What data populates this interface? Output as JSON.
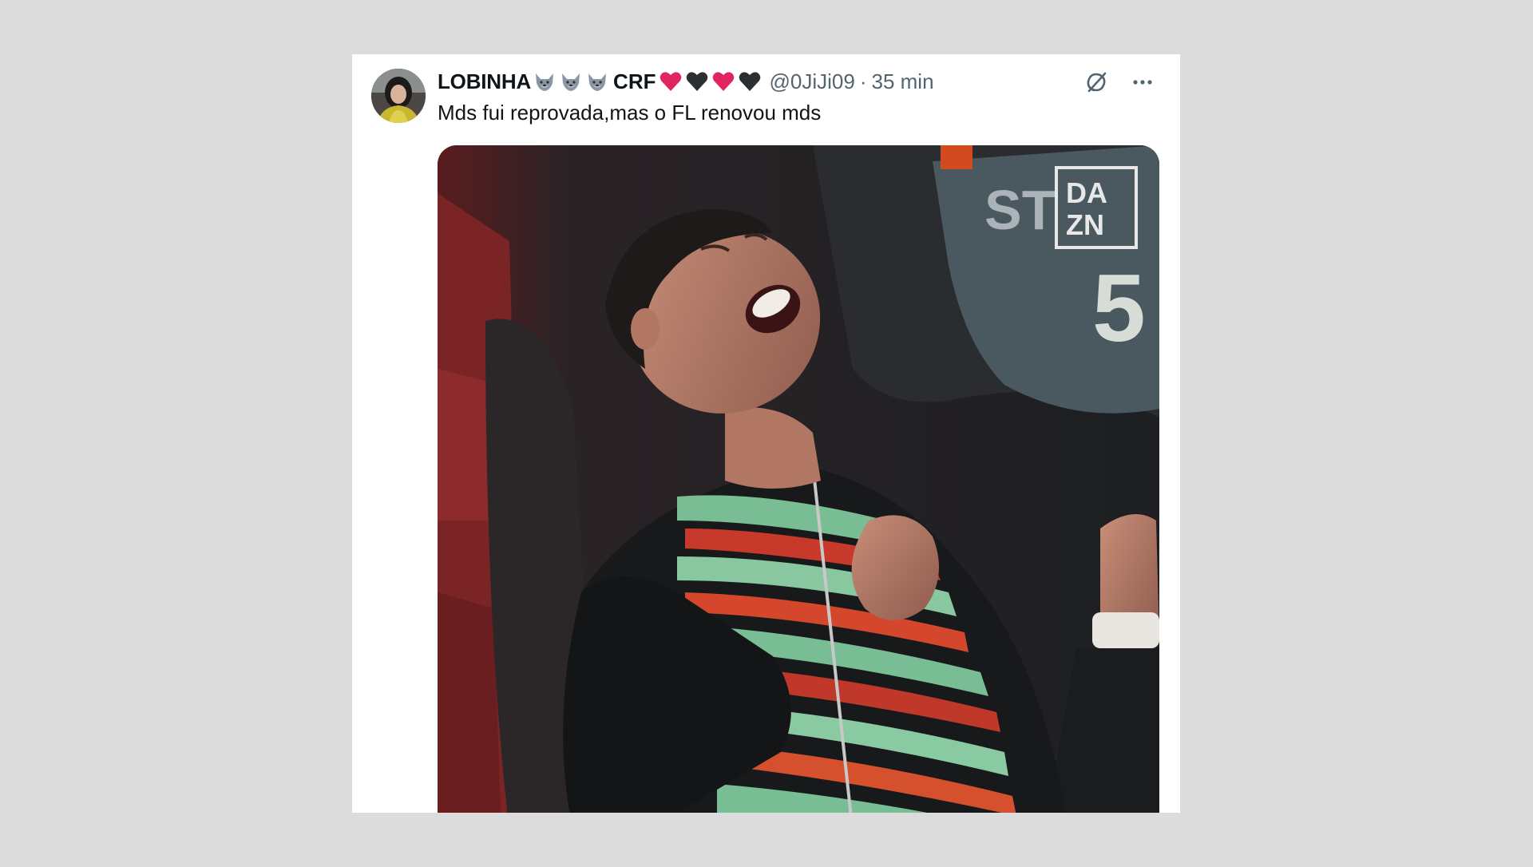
{
  "tweet": {
    "display_name": "LOBINHA",
    "display_name_suffix": "CRF",
    "name_emojis_before": [
      "wolf-emoji",
      "wolf-emoji",
      "wolf-emoji"
    ],
    "name_emojis_after": [
      "red-heart-emoji",
      "black-heart-emoji",
      "red-heart-emoji",
      "black-heart-emoji"
    ],
    "handle": "@0JiJi09",
    "separator": "·",
    "time": "35 min",
    "text": "Mds fui reprovada,mas o FL renovou mds",
    "media": {
      "watermark_lines": [
        "DA",
        "ZN"
      ],
      "bib_text": "ST",
      "bib_number": "5"
    }
  },
  "icons": {
    "grok": "grok-icon",
    "more": "more-icon"
  },
  "colors": {
    "page_background": "#dcdcdc",
    "card_background": "#ffffff",
    "text_primary": "#0f1419",
    "text_secondary": "#536471",
    "red_heart": "#e0245e",
    "black_heart": "#292f33"
  }
}
